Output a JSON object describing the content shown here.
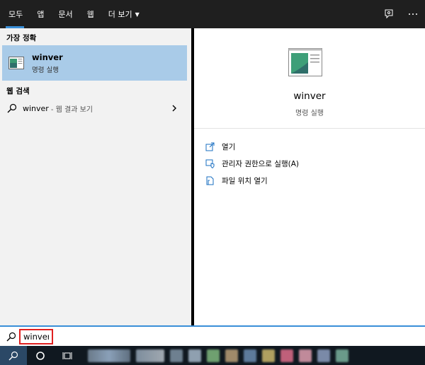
{
  "tabs": [
    {
      "label": "모두",
      "active": true
    },
    {
      "label": "앱"
    },
    {
      "label": "문서"
    },
    {
      "label": "웹"
    },
    {
      "label": "더 보기"
    }
  ],
  "icons": {
    "feedback": "feedback-icon",
    "more": "more-options-icon",
    "search": "search-icon",
    "cortana": "cortana-circle-icon",
    "taskview": "task-view-icon"
  },
  "left": {
    "best_match_header": "가장 정확",
    "best_match": {
      "name": "winver",
      "type": "명령 실행"
    },
    "web_header": "웹 검색",
    "web_query": "winver",
    "web_suffix": "- 웹 결과 보기"
  },
  "preview": {
    "title": "winver",
    "subtitle": "명령 실행",
    "actions": [
      {
        "label": "열기",
        "icon": "open-icon"
      },
      {
        "label": "관리자 권한으로 실행(A)",
        "icon": "run-as-admin-icon"
      },
      {
        "label": "파일 위치 열기",
        "icon": "open-file-location-icon"
      }
    ]
  },
  "search": {
    "value": "winver"
  },
  "colors": {
    "accent": "#3a8fd8",
    "selection": "#a9cbe8",
    "topbar": "#1f1f1f",
    "taskbar": "#101820",
    "highlight_box": "#e02020"
  }
}
